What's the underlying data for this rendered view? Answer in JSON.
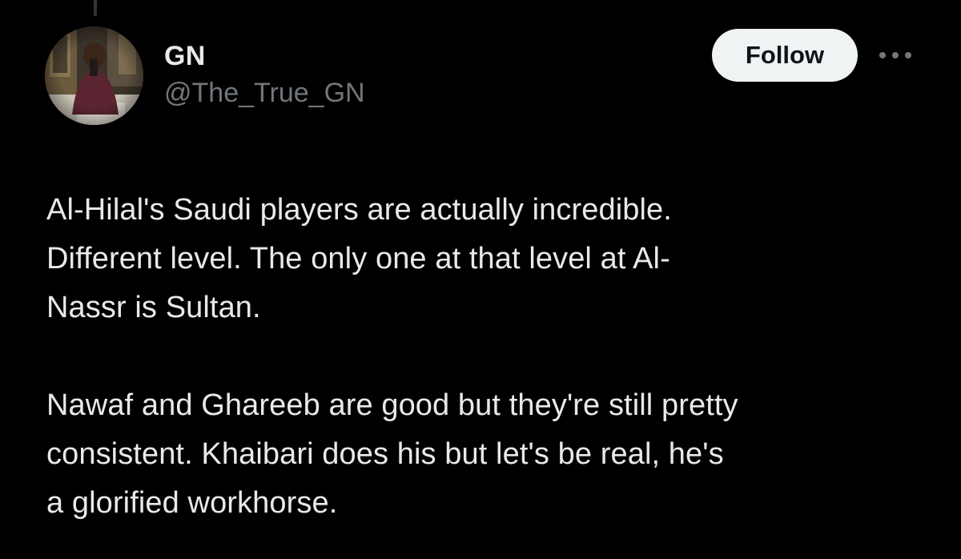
{
  "author": {
    "display_name": "GN",
    "handle": "@The_True_GN",
    "avatar_icon": "profile-photo"
  },
  "actions": {
    "follow_label": "Follow",
    "more_icon": "more-horizontal-icon"
  },
  "tweet": {
    "paragraphs": [
      {
        "lines": [
          "Al-Hilal's Saudi players are actually incredible.",
          "Different level. The only one at that level at Al-",
          "Nassr is Sultan."
        ]
      },
      {
        "lines": [
          "Nawaf and Ghareeb are good but they're still pretty",
          "consistent. Khaibari does his but let's be real, he's",
          "a glorified workhorse."
        ]
      }
    ]
  },
  "colors": {
    "background": "#000000",
    "primary_text": "#e7e9ea",
    "secondary_text": "#71767b",
    "follow_button_bg": "#eff3f4",
    "follow_button_text": "#0f1419"
  }
}
